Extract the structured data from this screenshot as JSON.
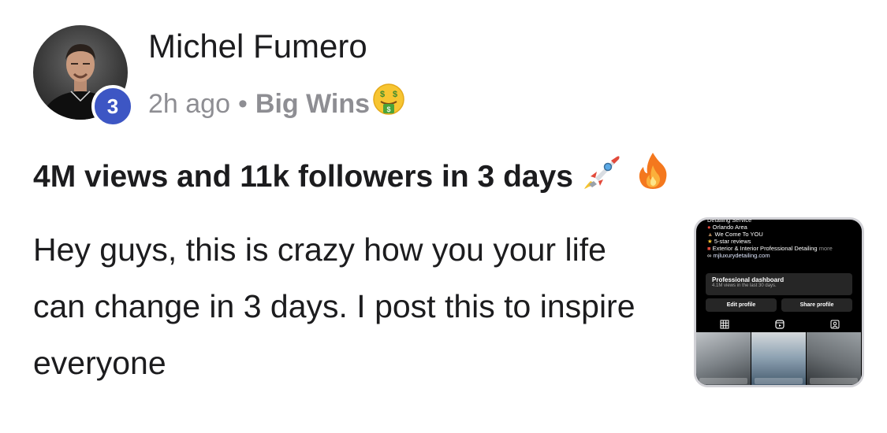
{
  "post": {
    "author": "Michel Fumero",
    "level": "3",
    "time_ago": "2h ago",
    "separator": "•",
    "group": "Big Wins",
    "group_emoji": "money-mouth-face-icon",
    "title": "4M views and 11k followers in 3 days",
    "title_emojis": [
      "rocket-icon",
      "fire-icon"
    ],
    "body": "Hey guys, this is crazy how you your life can change in 3 days. I post this to inspire everyone"
  },
  "thumbnail": {
    "bio_lines": [
      "Detailing Service",
      "Orlando Area",
      "We Come To YOU",
      "5-star reviews",
      "Exterior & Interior Professional Detailing"
    ],
    "more": "more",
    "link": "mjluxurydetailing.com",
    "dashboard_title": "Professional dashboard",
    "dashboard_sub": "4.1M views in the last 30 days.",
    "edit_profile": "Edit profile",
    "share_profile": "Share profile"
  },
  "colors": {
    "text_primary": "#1c1c1e",
    "text_secondary": "#8e8e93",
    "level_badge": "#3d56c4"
  }
}
